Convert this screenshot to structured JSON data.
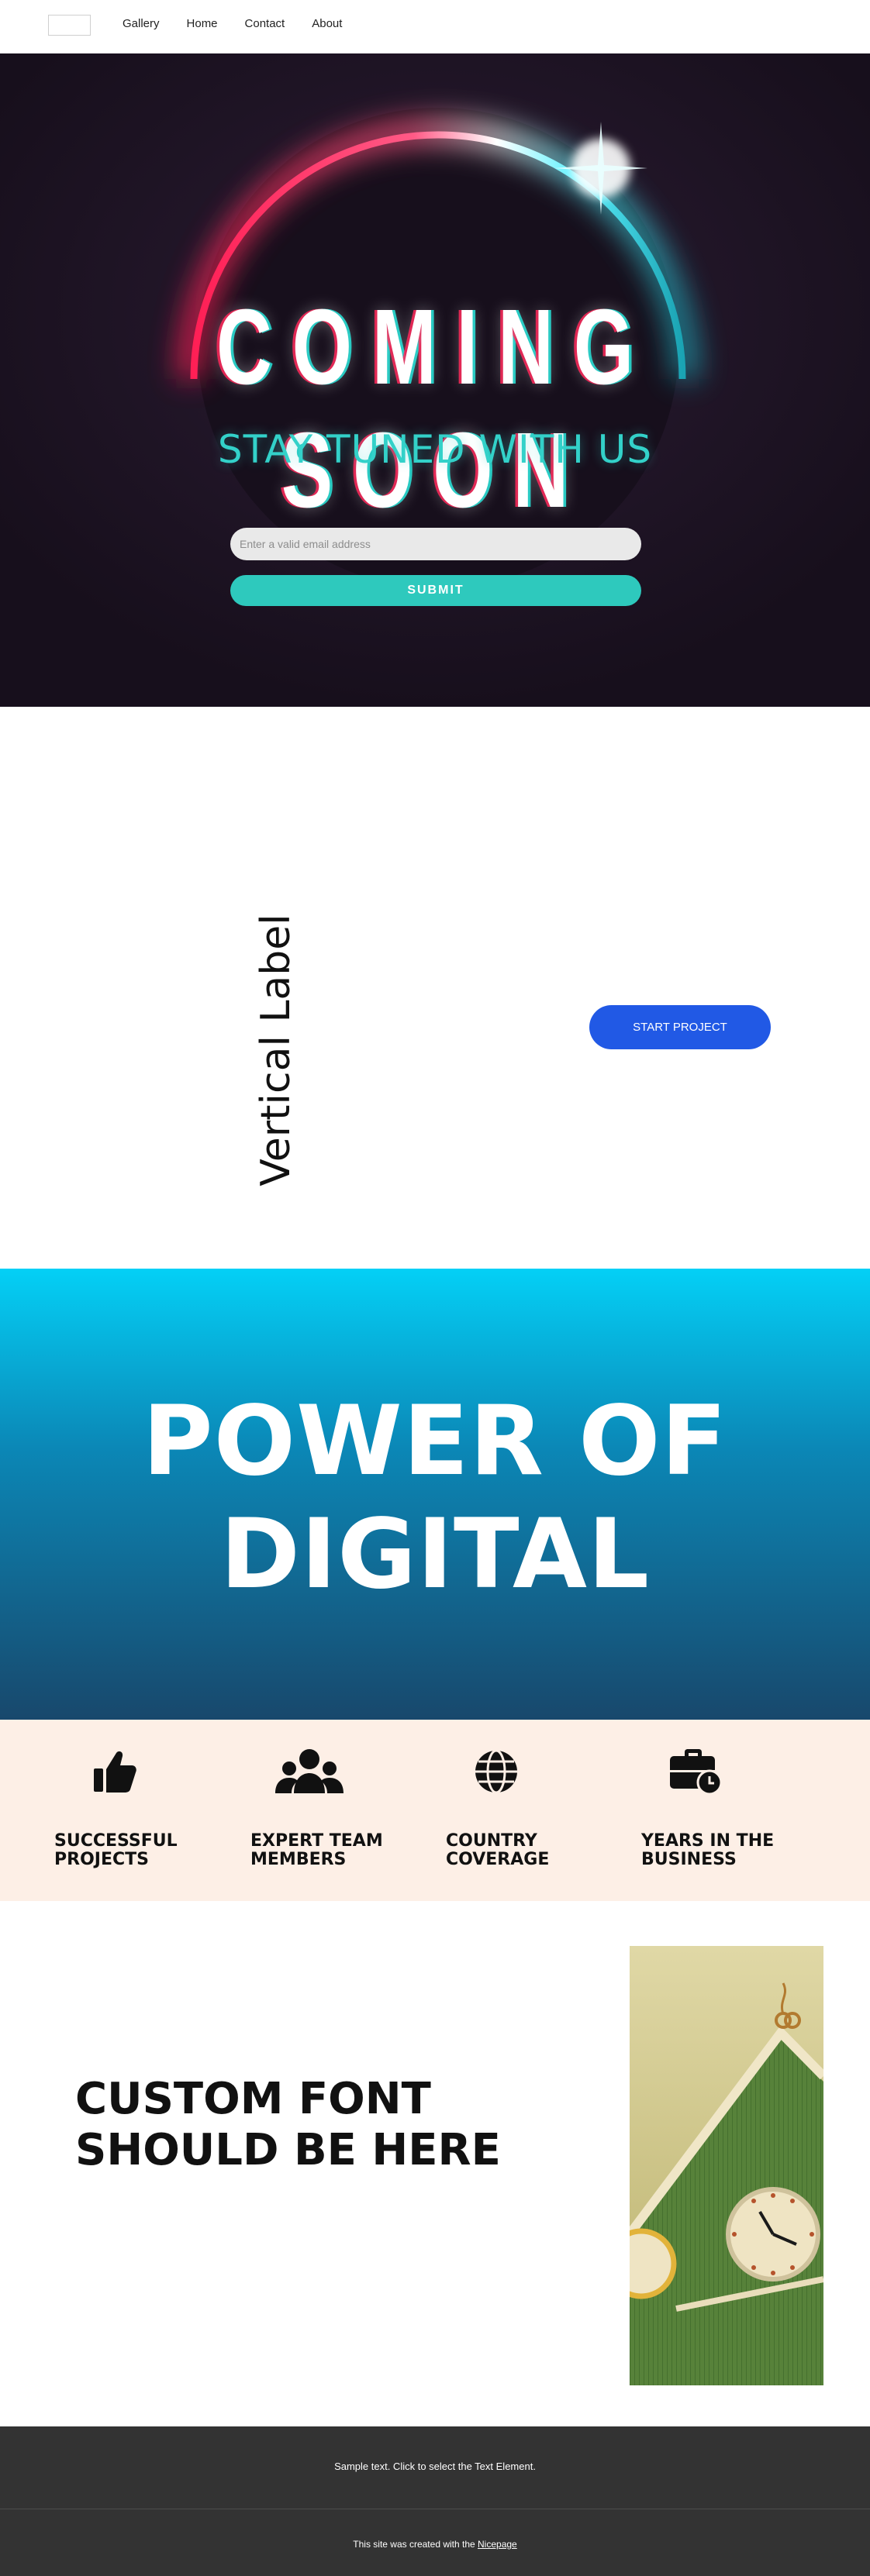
{
  "nav": {
    "items": [
      {
        "label": "Gallery"
      },
      {
        "label": "Home"
      },
      {
        "label": "Contact"
      },
      {
        "label": "About"
      }
    ]
  },
  "hero": {
    "title": "COMING SOON",
    "subtitle": "STAY TUNED WITH US",
    "email_placeholder": "Enter a valid email address",
    "email_value": "",
    "submit_label": "SUBMIT",
    "colors": {
      "background": "#1f1423",
      "accent": "#2ec9bd",
      "glow_pink": "#ff2d63"
    }
  },
  "vertical_section": {
    "label": "Vertical Label",
    "button_label": "START PROJECT",
    "button_color": "#2159e5"
  },
  "power": {
    "title_line1": "POWER OF",
    "title_line2": "DIGITAL"
  },
  "stats": [
    {
      "icon": "thumbs-up-icon",
      "label": "SUCCESSFUL PROJECTS"
    },
    {
      "icon": "team-icon",
      "label": "EXPERT TEAM MEMBERS"
    },
    {
      "icon": "globe-icon",
      "label": "COUNTRY COVERAGE"
    },
    {
      "icon": "briefcase-clock-icon",
      "label": "YEARS IN THE BUSINESS"
    }
  ],
  "custom": {
    "title": "CUSTOM FONT SHOULD BE HERE",
    "image_alt": "green building with clock"
  },
  "footer": {
    "text": "Sample text. Click to select the Text Element.",
    "credit_prefix": "This site was created with the ",
    "credit_link": "Nicepage"
  }
}
